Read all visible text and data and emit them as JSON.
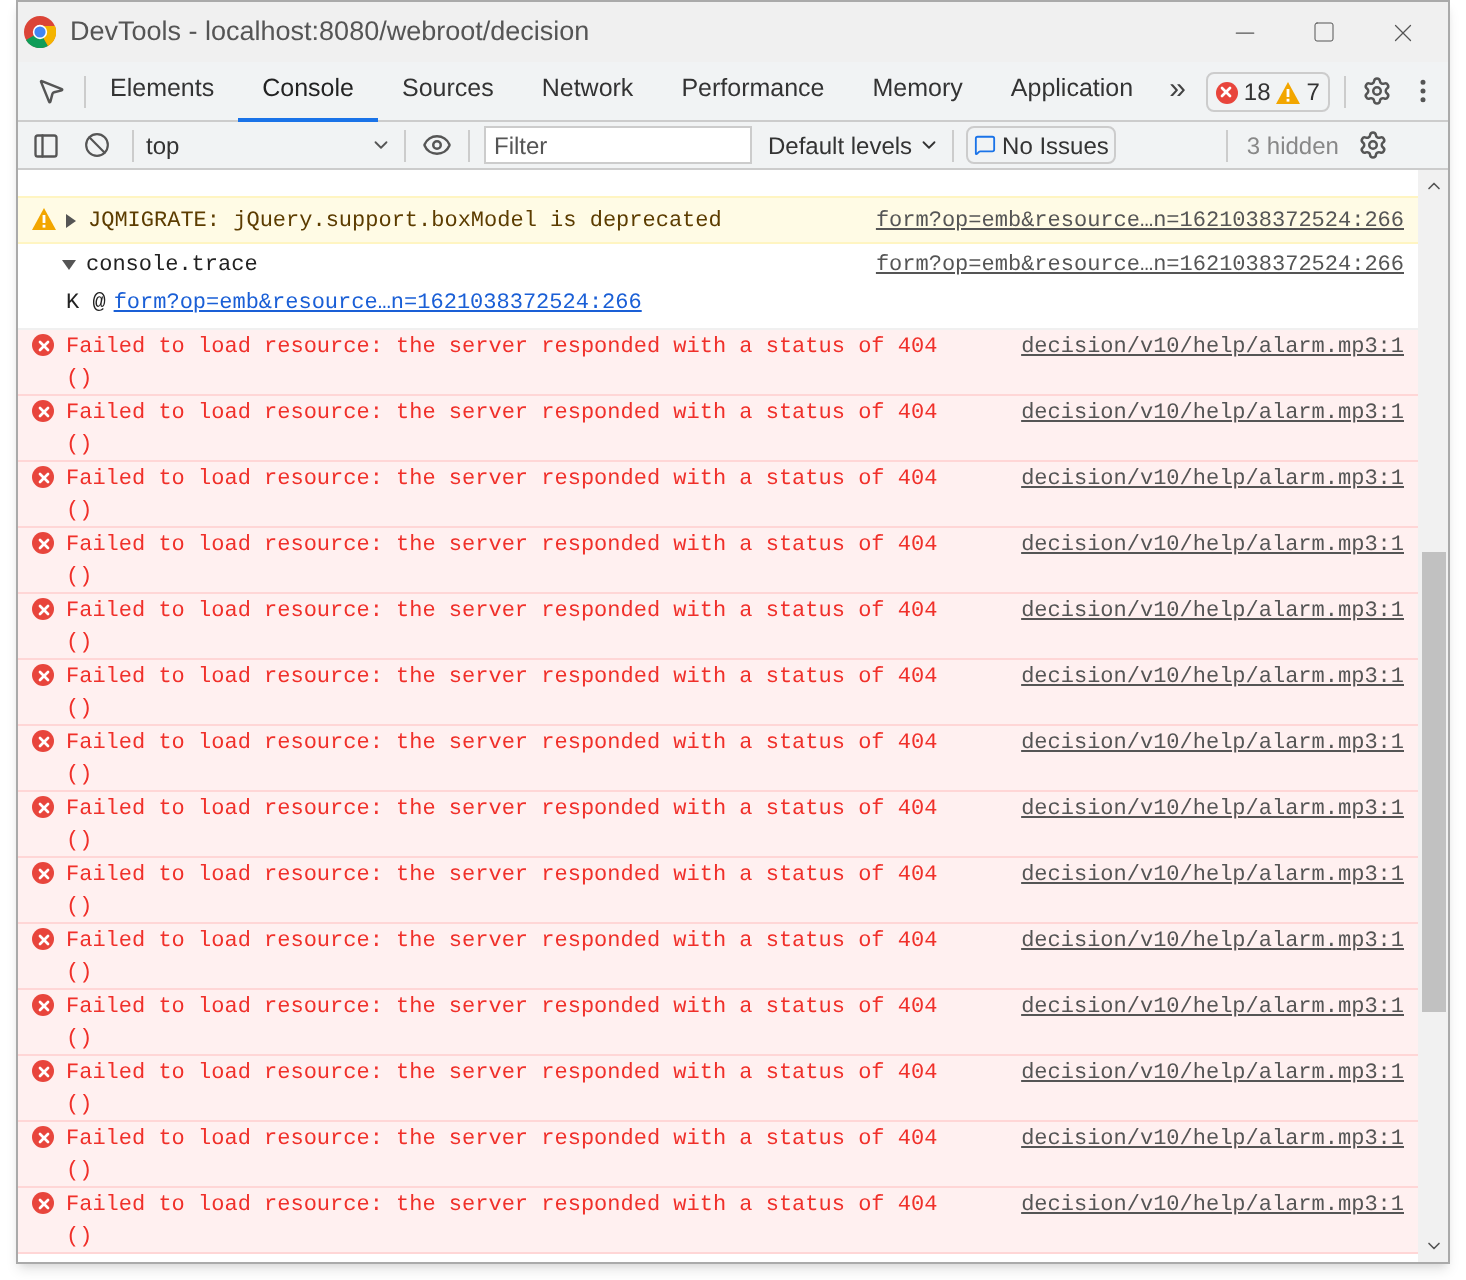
{
  "window": {
    "title": "DevTools - localhost:8080/webroot/decision"
  },
  "tabs": [
    {
      "label": "Elements",
      "selected": false
    },
    {
      "label": "Console",
      "selected": true
    },
    {
      "label": "Sources",
      "selected": false
    },
    {
      "label": "Network",
      "selected": false
    },
    {
      "label": "Performance",
      "selected": false
    },
    {
      "label": "Memory",
      "selected": false
    },
    {
      "label": "Application",
      "selected": false
    }
  ],
  "more_tabs": "»",
  "counts": {
    "errors": "18",
    "warnings": "7"
  },
  "toolbar": {
    "context": "top",
    "filter_placeholder": "Filter",
    "levels": "Default levels",
    "issues": "No Issues",
    "hidden": "3 hidden"
  },
  "messages": [
    {
      "kind": "warning",
      "text": "JQMIGRATE: jQuery.support.boxModel is deprecated",
      "source": "form?op=emb&resource…n=1621038372524:266",
      "expanded": false
    },
    {
      "kind": "trace",
      "text": "console.trace",
      "source": "form?op=emb&resource…n=1621038372524:266",
      "expanded": true,
      "frame": "K @",
      "frame_link": "form?op=emb&resource…n=1621038372524:266"
    },
    {
      "kind": "error",
      "text": "Failed to load resource: the server responded with a status of 404",
      "detail": "()",
      "source": "decision/v10/help/alarm.mp3:1"
    },
    {
      "kind": "error",
      "text": "Failed to load resource: the server responded with a status of 404",
      "detail": "()",
      "source": "decision/v10/help/alarm.mp3:1"
    },
    {
      "kind": "error",
      "text": "Failed to load resource: the server responded with a status of 404",
      "detail": "()",
      "source": "decision/v10/help/alarm.mp3:1"
    },
    {
      "kind": "error",
      "text": "Failed to load resource: the server responded with a status of 404",
      "detail": "()",
      "source": "decision/v10/help/alarm.mp3:1"
    },
    {
      "kind": "error",
      "text": "Failed to load resource: the server responded with a status of 404",
      "detail": "()",
      "source": "decision/v10/help/alarm.mp3:1"
    },
    {
      "kind": "error",
      "text": "Failed to load resource: the server responded with a status of 404",
      "detail": "()",
      "source": "decision/v10/help/alarm.mp3:1"
    },
    {
      "kind": "error",
      "text": "Failed to load resource: the server responded with a status of 404",
      "detail": "()",
      "source": "decision/v10/help/alarm.mp3:1"
    },
    {
      "kind": "error",
      "text": "Failed to load resource: the server responded with a status of 404",
      "detail": "()",
      "source": "decision/v10/help/alarm.mp3:1"
    },
    {
      "kind": "error",
      "text": "Failed to load resource: the server responded with a status of 404",
      "detail": "()",
      "source": "decision/v10/help/alarm.mp3:1"
    },
    {
      "kind": "error",
      "text": "Failed to load resource: the server responded with a status of 404",
      "detail": "()",
      "source": "decision/v10/help/alarm.mp3:1"
    },
    {
      "kind": "error",
      "text": "Failed to load resource: the server responded with a status of 404",
      "detail": "()",
      "source": "decision/v10/help/alarm.mp3:1"
    },
    {
      "kind": "error",
      "text": "Failed to load resource: the server responded with a status of 404",
      "detail": "()",
      "source": "decision/v10/help/alarm.mp3:1"
    },
    {
      "kind": "error",
      "text": "Failed to load resource: the server responded with a status of 404",
      "detail": "()",
      "source": "decision/v10/help/alarm.mp3:1"
    },
    {
      "kind": "error",
      "text": "Failed to load resource: the server responded with a status of 404",
      "detail": "()",
      "source": "decision/v10/help/alarm.mp3:1"
    }
  ]
}
